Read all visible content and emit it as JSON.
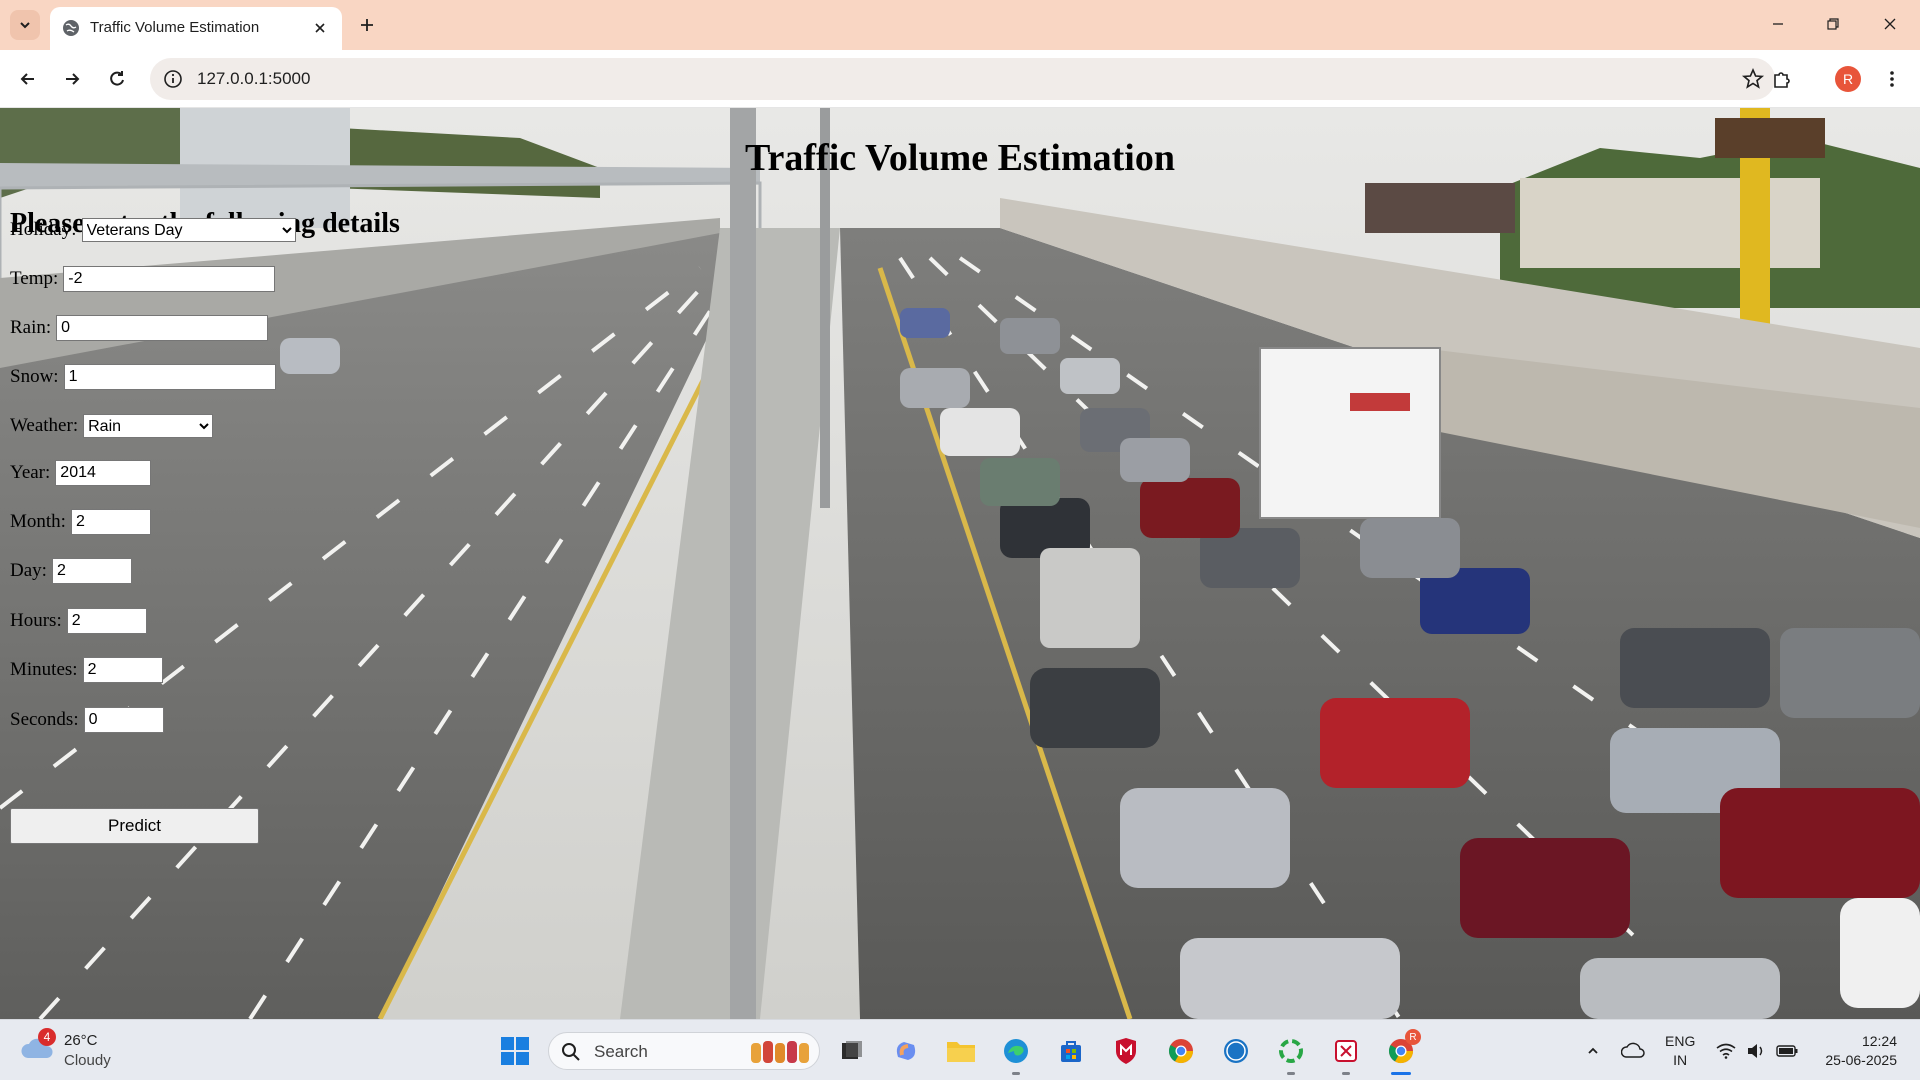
{
  "browser": {
    "tab_title": "Traffic Volume Estimation",
    "url": "127.0.0.1:5000",
    "profile_initial": "R"
  },
  "page": {
    "title": "Traffic Volume Estimation",
    "form_heading": "Please enter the following details",
    "fields": {
      "holiday": {
        "label": "Holiday:",
        "value": "Veterans Day"
      },
      "temp": {
        "label": "Temp:",
        "value": "-2"
      },
      "rain": {
        "label": "Rain:",
        "value": "0"
      },
      "snow": {
        "label": "Snow:",
        "value": "1"
      },
      "weather": {
        "label": "Weather:",
        "value": "Rain"
      },
      "year": {
        "label": "Year:",
        "value": "2014"
      },
      "month": {
        "label": "Month:",
        "value": "2"
      },
      "day": {
        "label": "Day:",
        "value": "2"
      },
      "hours": {
        "label": "Hours:",
        "value": "2"
      },
      "minutes": {
        "label": "Minutes:",
        "value": "2"
      },
      "seconds": {
        "label": "Seconds:",
        "value": "0"
      }
    },
    "predict_label": "Predict",
    "background_image": "highway-traffic-photo"
  },
  "taskbar": {
    "weather_badge": "4",
    "weather_temp": "26°C",
    "weather_desc": "Cloudy",
    "search_label": "Search",
    "lang_line1": "ENG",
    "lang_line2": "IN",
    "time": "12:24",
    "date": "25-06-2025",
    "chrome_badge": "R"
  },
  "colors": {
    "tabbar": "#f9d6c3",
    "avatar": "#e8553a",
    "taskbar": "#e7eaf0"
  }
}
